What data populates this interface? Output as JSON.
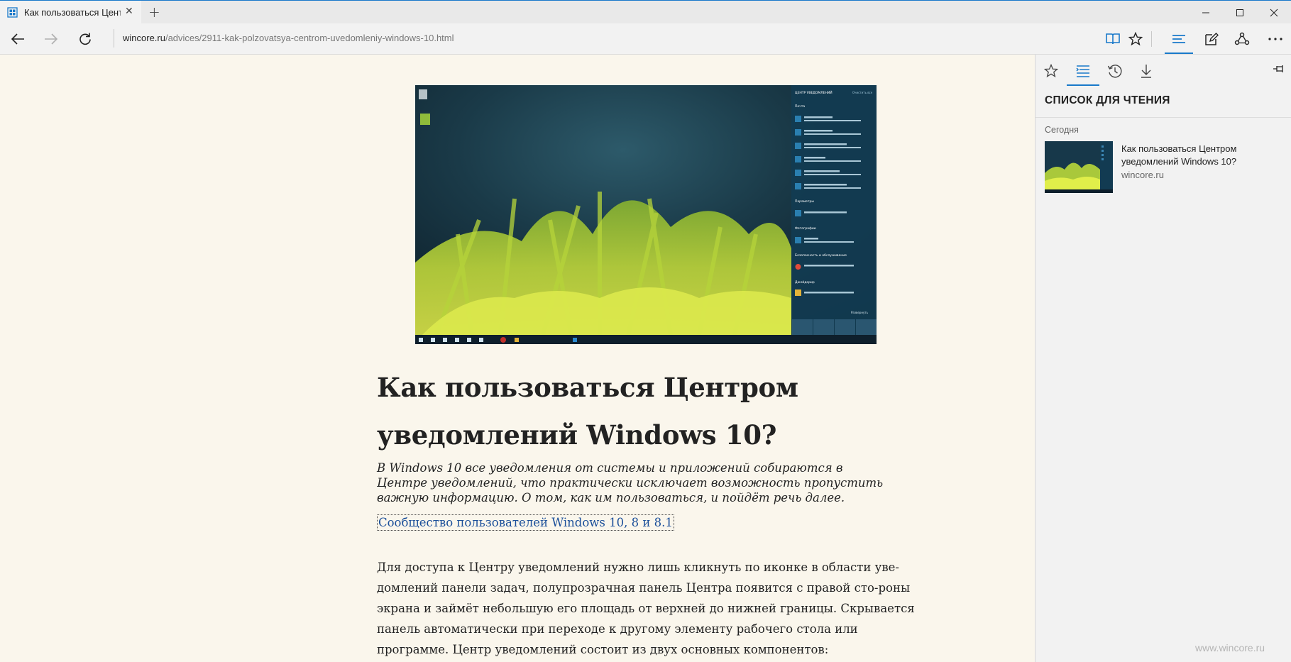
{
  "tab": {
    "title": "Как пользоваться Цент",
    "new_tab_glyph": "+",
    "close_glyph": "✕"
  },
  "window": {
    "minimize_glyph": "—",
    "maximize_glyph": "☐",
    "close_glyph": "✕"
  },
  "address": {
    "host": "wincore.ru",
    "path": "/advices/2911-kak-polzovatsya-centrom-uvedomleniy-windows-10.html"
  },
  "article": {
    "title": "Как пользоваться Центром уведомлений Windows 10?",
    "lead": "В Windows 10 все уведомления от системы и приложений собираются в Центре уведомлений, что практически исключает возможность пропустить важную информацию. О том, как им пользоваться, и пойдёт речь далее.",
    "link": "Сообщество пользователей Windows 10, 8 и 8.1",
    "body": "Для доступа к Центру уведомлений нужно лишь кликнуть по иконке в области уве-домлений панели задач, полупрозрачная панель Центра появится с правой сто-роны экрана и займёт небольшую его площадь от верхней до нижней границы. Скрывается панель автоматически при переходе к другому элементу рабочего стола или программе. Центр уведомлений состоит из двух основных компонентов:"
  },
  "hero_panel": {
    "header": "ЦЕНТР УВЕДОМЛЕНИЙ",
    "clear": "Очистить все",
    "section1": "Почта",
    "section2": "Параметры",
    "section3": "Фотографии",
    "section4": "Безопасность и обслуживание",
    "section5": "Джейдорир",
    "expand": "Развернуть"
  },
  "hub": {
    "heading": "СПИСОК ДЛЯ ЧТЕНИЯ",
    "group": "Сегодня",
    "items": [
      {
        "title": "Как пользоваться Центром уведомлений Windows 10?",
        "domain": "wincore.ru"
      }
    ]
  },
  "watermark": "www.wincore.ru",
  "colors": {
    "accent": "#1979ca",
    "reader_bg": "#faf6ec",
    "link": "#1b4f9a"
  }
}
